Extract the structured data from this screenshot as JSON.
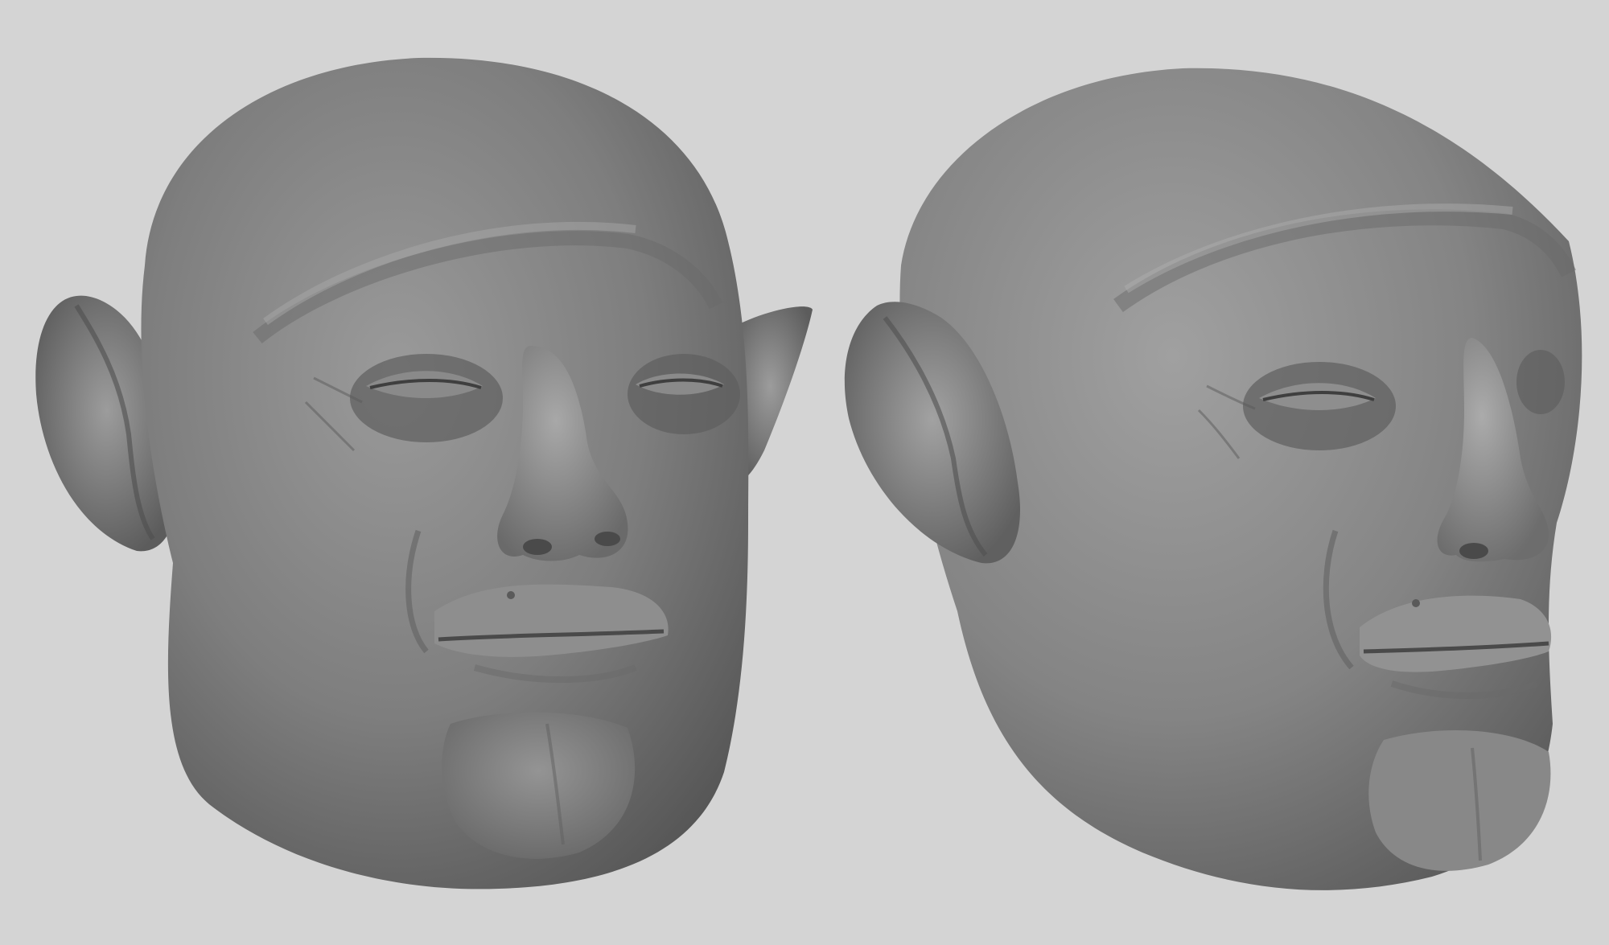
{
  "scene": {
    "background_color": "#d4d4d4",
    "material_color": "#8a8a8a",
    "views": [
      {
        "name": "front-three-quarter-view"
      },
      {
        "name": "side-three-quarter-view"
      }
    ]
  }
}
